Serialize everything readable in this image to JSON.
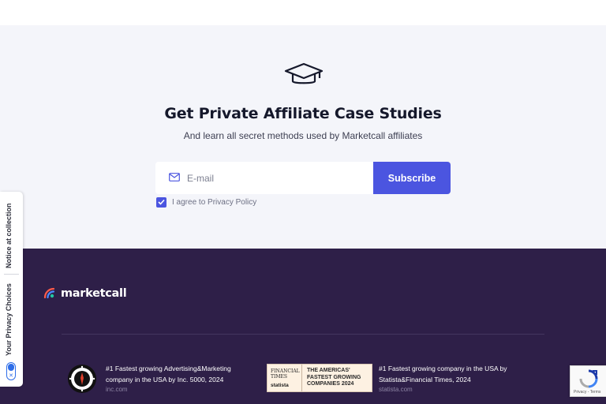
{
  "hero": {
    "icon": "graduation-cap-icon",
    "title": "Get Private Affiliate Case Studies",
    "subtitle": "And learn all secret methods used by Marketcall affiliates"
  },
  "form": {
    "email_icon": "mail-icon",
    "email_placeholder": "E-mail",
    "email_value": "",
    "subscribe_label": "Subscribe",
    "agree_checked": true,
    "agree_label": "I agree to Privacy Policy"
  },
  "footer": {
    "logo_text": "marketcall",
    "awards": [
      {
        "badge": "inc-5000-badge",
        "description": "#1 Fastest growing Advertising&Marketing company in the USA by Inc. 5000, 2024",
        "source": "inc.com"
      },
      {
        "badge": "ft-statista-badge",
        "badge_left_top": "FINANCIAL TIMES",
        "badge_left_bottom": "statista",
        "badge_lines": [
          "THE AMERICAS'",
          "FASTEST GROWING",
          "COMPANIES 2024"
        ],
        "description": "#1 Fastest growing company in the USA by Statista&Financial Times, 2024",
        "source": "statista.com"
      }
    ]
  },
  "privacy_tab": {
    "notice": "Notice at collection",
    "choices": "Your Privacy Choices"
  },
  "recaptcha": {
    "links": "Privacy - Terms"
  },
  "colors": {
    "accent": "#4b55e0",
    "footer_bg": "#2e1f48",
    "hero_bg": "#f4f5fa"
  }
}
